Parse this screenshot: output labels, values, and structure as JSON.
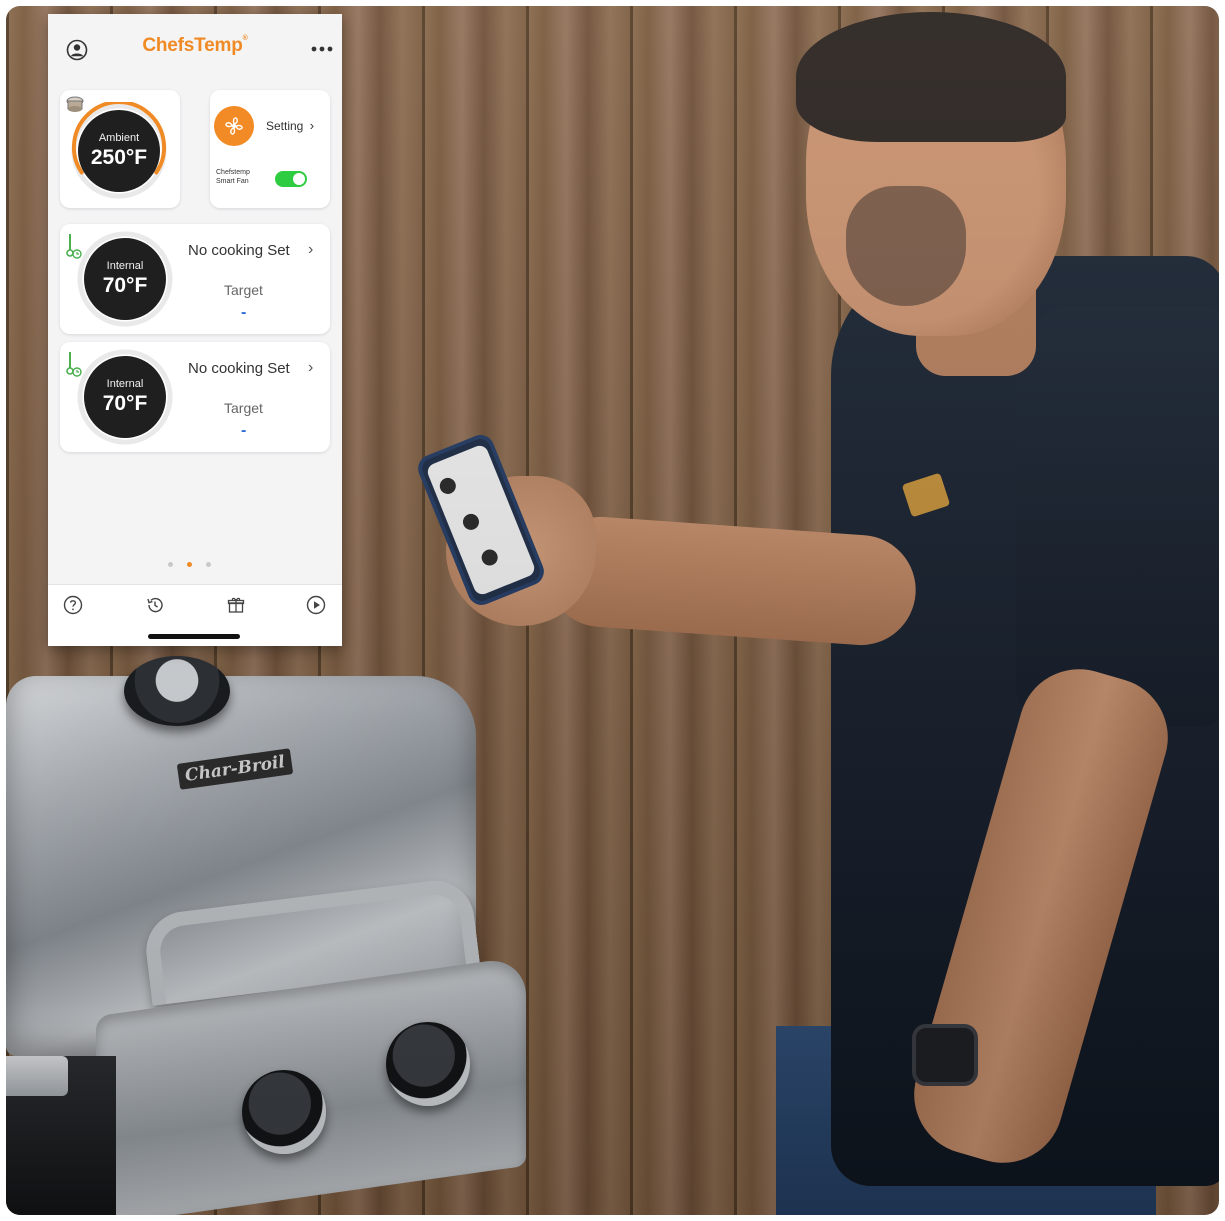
{
  "app": {
    "title": "ChefsTemp",
    "title_mark": "®",
    "brand_color": "#f08a24"
  },
  "header": {
    "user_icon": "user-circle-icon",
    "more_icon": "more-dots-icon"
  },
  "ambient": {
    "label": "Ambient",
    "value": "250°F",
    "device_icon": "thermometer-device-icon"
  },
  "fan": {
    "icon": "fan-icon",
    "setting_label": "Setting",
    "name_line1": "Chefstemp",
    "name_line2": "Smart Fan",
    "enabled": true,
    "toggle_color": "#2ecc40"
  },
  "probes": [
    {
      "label": "Internal",
      "value": "70°F",
      "status": "No cooking Set",
      "target_label": "Target",
      "target_value": "-"
    },
    {
      "label": "Internal",
      "value": "70°F",
      "status": "No cooking Set",
      "target_label": "Target",
      "target_value": "-"
    }
  ],
  "pager": {
    "count": 3,
    "active_index": 1
  },
  "tabbar": {
    "items": [
      "help-icon",
      "history-icon",
      "gift-icon",
      "play-icon"
    ]
  },
  "photo": {
    "grill_brand": "Char-Broil"
  }
}
